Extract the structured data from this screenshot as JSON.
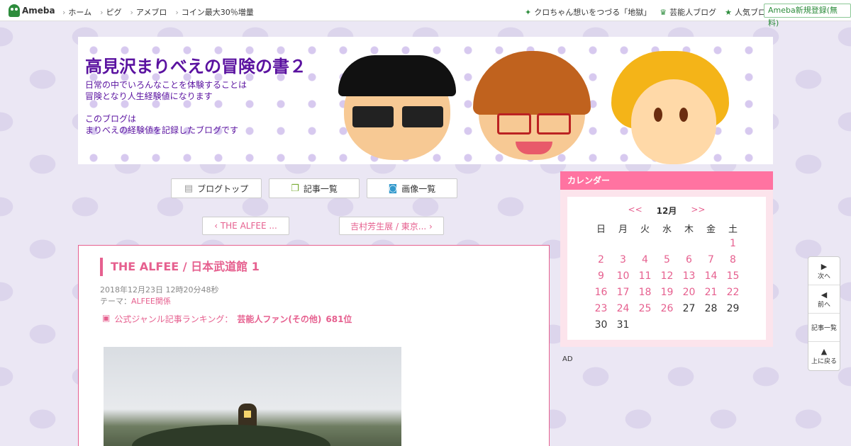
{
  "topbar": {
    "logo": "Ameba",
    "left_links": [
      "ホーム",
      "ピグ",
      "アメブロ",
      "コイン最大30％増量"
    ],
    "right_links": [
      {
        "icon": "✦",
        "label": "クロちゃん想いをつづる「地獄」"
      },
      {
        "icon": "♛",
        "label": "芸能人ブログ"
      },
      {
        "icon": "★",
        "label": "人気ブログ"
      }
    ],
    "register": "Ameba新規登録(無料)"
  },
  "header": {
    "title": "高見沢まりべえの冒険の書２",
    "desc": [
      "日常の中でいろんなことを体験することは",
      "冒険となり人生経験値になります",
      "",
      "このブログは",
      "まりべえの経験値を記録したブログです"
    ]
  },
  "nav": {
    "blogtop": "ブログトップ",
    "articles": "記事一覧",
    "images": "画像一覧",
    "prev": "‹ THE ALFEE ...",
    "next": "吉村芳生展 / 東京... ›"
  },
  "article": {
    "title": "THE ALFEE / 日本武道館 1",
    "date": "2018年12月23日 12時20分48秒",
    "theme_label": "テーマ：",
    "theme": "ALFEE関係",
    "ranking_label": "公式ジャンル記事ランキング：",
    "ranking_genre": "芸能人ファン(その他)",
    "ranking_rank": "681位"
  },
  "calendar": {
    "header": "カレンダー",
    "prev": "<<",
    "month": "12月",
    "next": ">>",
    "weekdays": [
      "日",
      "月",
      "火",
      "水",
      "木",
      "金",
      "土"
    ],
    "first_weekday": 6,
    "days": 31,
    "linked_days": [
      1,
      2,
      3,
      4,
      5,
      6,
      7,
      8,
      9,
      10,
      11,
      12,
      13,
      14,
      15,
      16,
      17,
      18,
      19,
      20,
      21,
      22,
      23,
      24,
      25,
      26
    ]
  },
  "sidebar": {
    "ad": "AD"
  },
  "float_nav": [
    {
      "icon": "▶",
      "label": "次へ"
    },
    {
      "icon": "◀",
      "label": "前へ"
    },
    {
      "icon": "",
      "label": "記事一覧"
    },
    {
      "icon": "▲",
      "label": "上に戻る"
    }
  ],
  "colors": {
    "accent": "#e6608f",
    "title_purple": "#5a12a0",
    "ameba_green": "#2d8c3c"
  }
}
